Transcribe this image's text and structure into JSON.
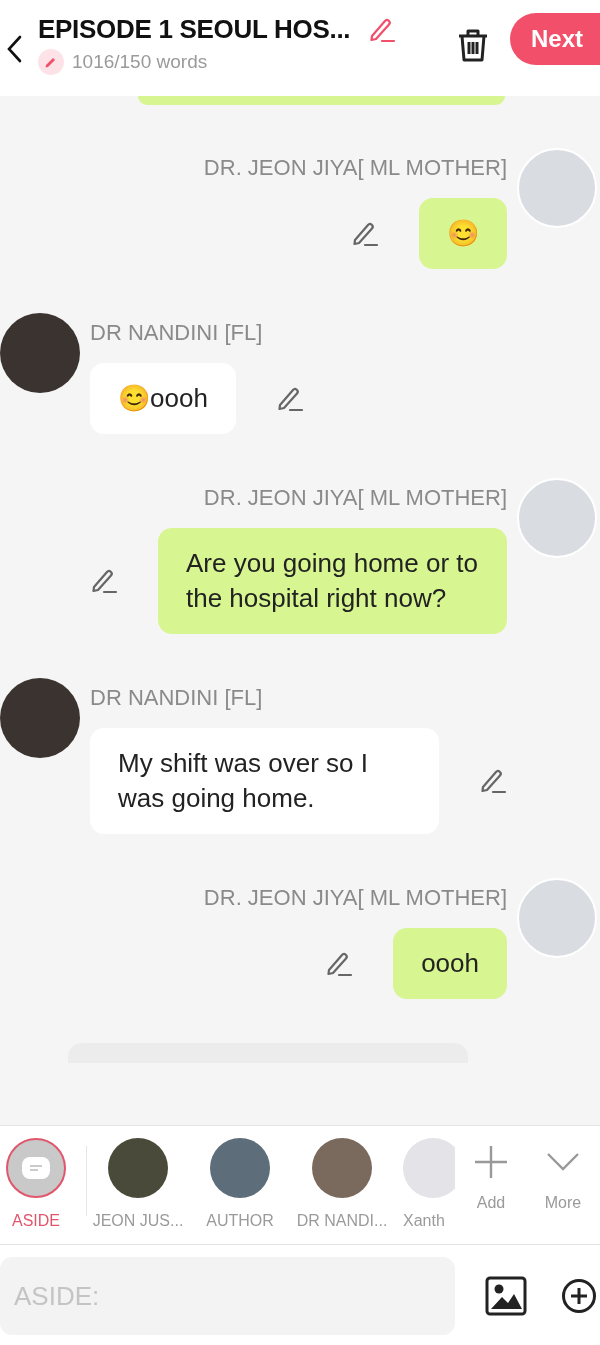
{
  "header": {
    "title": "EPISODE 1 SEOUL HOS...",
    "word_count": "1016/150 words",
    "next_button": "Next"
  },
  "messages": [
    {
      "kind": "sent",
      "speaker": "DR. JEON JIYA[ ML MOTHER]",
      "text": "😊"
    },
    {
      "kind": "received",
      "speaker": "DR NANDINI [FL]",
      "text": "😊oooh"
    },
    {
      "kind": "sent",
      "speaker": "DR. JEON JIYA[ ML MOTHER]",
      "text": "Are you going home or to the hospital right now?"
    },
    {
      "kind": "received",
      "speaker": "DR NANDINI [FL]",
      "text": "My shift was over so I was going home."
    },
    {
      "kind": "sent",
      "speaker": "DR. JEON JIYA[ ML MOTHER]",
      "text": "oooh"
    }
  ],
  "characters": [
    {
      "kind": "aside",
      "name": "ASIDE",
      "selected": true
    },
    {
      "kind": "photo",
      "name": "JEON JUS...",
      "selected": false
    },
    {
      "kind": "photo",
      "name": "AUTHOR",
      "selected": false
    },
    {
      "kind": "photo",
      "name": "DR NANDI...",
      "selected": false
    },
    {
      "kind": "faded",
      "name": "Xanth",
      "selected": false
    }
  ],
  "actions": [
    {
      "kind": "add",
      "label": "Add"
    },
    {
      "kind": "more",
      "label": "More"
    }
  ],
  "composer": {
    "placeholder": "ASIDE:"
  }
}
